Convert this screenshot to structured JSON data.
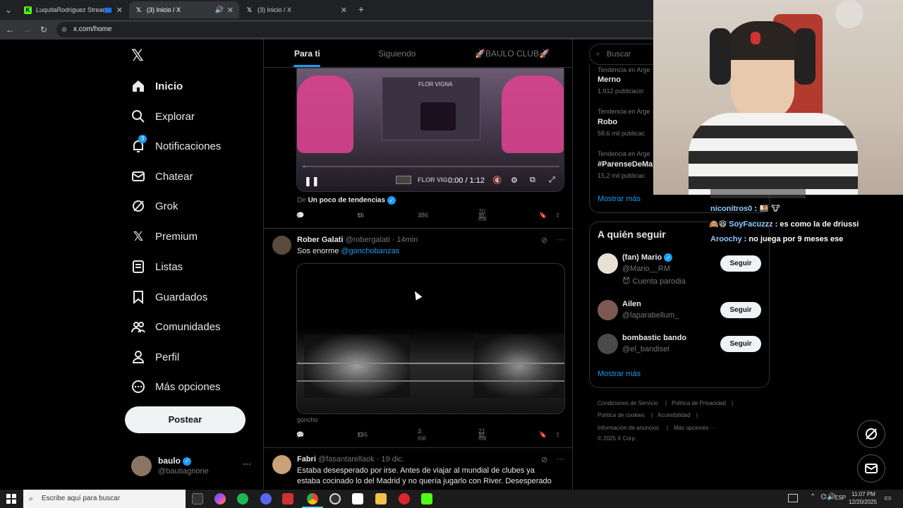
{
  "browser": {
    "tabs": [
      {
        "label": "LuquitaRodriguez Stream - ",
        "active": false
      },
      {
        "label": "(3) Inicio / X",
        "active": true
      },
      {
        "label": "(3) Inicio / X",
        "active": false
      }
    ],
    "url": "x.com/home"
  },
  "nav": {
    "items": [
      "Inicio",
      "Explorar",
      "Notificaciones",
      "Chatear",
      "Grok",
      "Premium",
      "Listas",
      "Guardados",
      "Comunidades",
      "Perfil",
      "Más opciones"
    ],
    "notif_badge": "3",
    "post_label": "Postear",
    "profile": {
      "name": "baulo",
      "handle": "@bautiagnone",
      "more": "···"
    }
  },
  "feed": {
    "tabs": [
      "Para ti",
      "Siguiendo",
      "🚀BAULO CLUB🚀"
    ],
    "video1": {
      "banner": "FLOR VIGNA",
      "watermark": "FLOR VIG",
      "time": "0:00 / 1:12"
    },
    "tweet1_from_prefix": "De",
    "tweet1_from": "Un poco de tendencias",
    "tweet1_stats": {
      "replies": "6",
      "retweets": "16",
      "likes": "386",
      "views": "70 mil"
    },
    "tweet2": {
      "name": "Rober Galati",
      "handle": "@robergalati",
      "time": "· 14min",
      "text": "Sos enorme",
      "mention": "@gonchobanzas",
      "caption": "goncho",
      "stats": {
        "replies": "22",
        "retweets": "136",
        "likes": "3 mil",
        "views": "21 mil"
      }
    },
    "tweet3": {
      "name": "Fabri",
      "handle": "@fasantarellaok",
      "time": "· 19 dic.",
      "text1": "Estaba desesperado por irse. Antes de viajar al mundial de clubes ya",
      "text2": "estaba cocinado lo del Madrid y no quería jugarlo con River. Desesperado"
    }
  },
  "right": {
    "search_placeholder": "Buscar",
    "trends": [
      {
        "meta": "Tendencia en Arge",
        "name": "Merno",
        "count": "1.912 publicacio"
      },
      {
        "meta": "Tendencia en Arge",
        "name": "Robo",
        "count": "58,6 mil publicac"
      },
      {
        "meta": "Tendencia en Arge",
        "name": "#ParenseDeMa",
        "count": "15,2 mil publicac"
      }
    ],
    "show_more": "Mostrar más",
    "who_title": "A quién seguir",
    "follow": [
      {
        "name": "(fan) Mario",
        "handle": "@Mario__RM",
        "extra": "😈 Cuenta parodia",
        "btn": "Seguir"
      },
      {
        "name": "Ailen",
        "handle": "@laparabellum_",
        "btn": "Seguir"
      },
      {
        "name": "bombastic bando",
        "handle": "@el_bandisel",
        "btn": "Seguir"
      }
    ],
    "show_more2": "Mostrar más",
    "footer": [
      "Condiciones de Servicio",
      "|",
      "Política de Privacidad",
      "|",
      "Política de cookies",
      "|",
      "Accesibilidad",
      "|",
      "Información de anuncios",
      "|",
      "Más opciones ···",
      "© 2025 X Corp."
    ]
  },
  "chat": [
    {
      "user": "niconitros0",
      "msg": " : 🍱 🐮"
    },
    {
      "user": "SoyFacuzzz",
      "msg": " : es como la de driussi",
      "prefix": "🙈😆 "
    },
    {
      "user": "Aroochy",
      "msg": " : no juega por 9 meses ese"
    }
  ],
  "taskbar": {
    "search_placeholder": "Escribe aquí para buscar",
    "lang": "ESP",
    "time": "11:07 PM",
    "date": "12/20/2025"
  },
  "colors": {
    "accent": "#1d9bf0",
    "bg": "#000000",
    "border": "#2f3336",
    "muted": "#71767b"
  }
}
